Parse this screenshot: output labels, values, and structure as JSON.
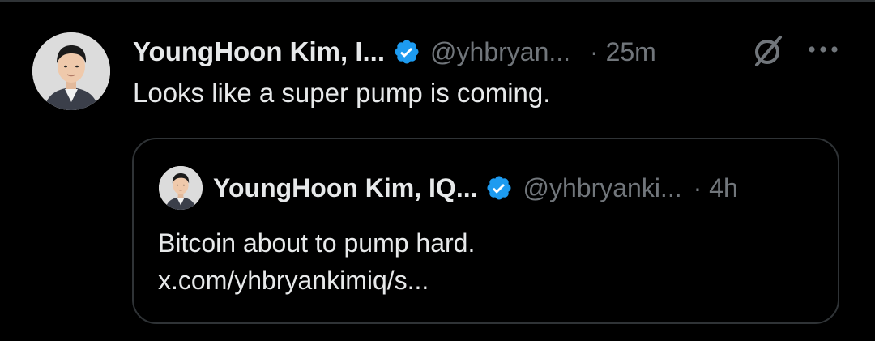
{
  "tweet": {
    "author_name": "YoungHoon Kim, I...",
    "handle": "@yhbryan...",
    "time": "· 25m",
    "text": "Looks like a super pump is coming.",
    "verified": true
  },
  "quoted_tweet": {
    "author_name": "YoungHoon Kim, IQ...",
    "handle": "@yhbryanki...",
    "time": "· 4h",
    "text_line1": "Bitcoin about to pump hard.",
    "text_line2": "x.com/yhbryankimiq/s...",
    "verified": true
  },
  "icons": {
    "verified": "verified-badge-icon",
    "grok": "grok-icon",
    "more": "more-options-icon"
  },
  "colors": {
    "background": "#000000",
    "primary_text": "#e7e9ea",
    "secondary_text": "#71767b",
    "verified_blue": "#1d9bf0",
    "border": "#2f3336"
  }
}
